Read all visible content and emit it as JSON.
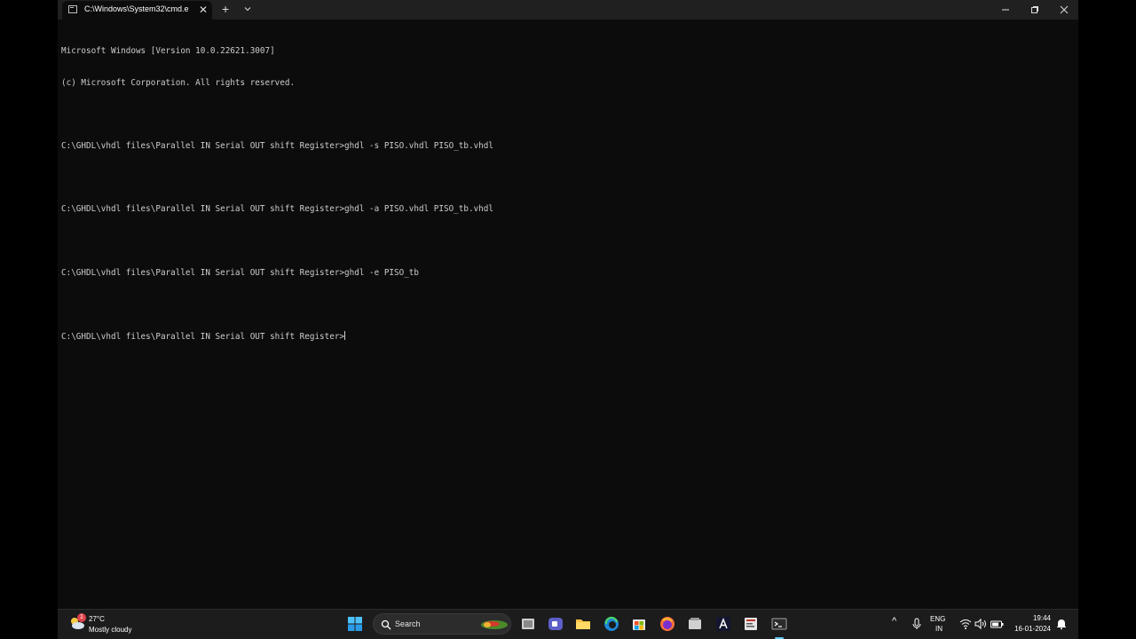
{
  "window": {
    "tab_title": "C:\\Windows\\System32\\cmd.e",
    "tab_close_glyph": "✕",
    "new_tab_glyph": "+",
    "icons": [
      "console-icon",
      "chevron-down-icon",
      "minimize-icon",
      "maximize-icon",
      "close-icon"
    ]
  },
  "console": {
    "lines": [
      "Microsoft Windows [Version 10.0.22621.3007]",
      "(c) Microsoft Corporation. All rights reserved.",
      "",
      "C:\\GHDL\\vhdl files\\Parallel IN Serial OUT shift Register>ghdl -s PISO.vhdl PISO_tb.vhdl",
      "",
      "C:\\GHDL\\vhdl files\\Parallel IN Serial OUT shift Register>ghdl -a PISO.vhdl PISO_tb.vhdl",
      "",
      "C:\\GHDL\\vhdl files\\Parallel IN Serial OUT shift Register>ghdl -e PISO_tb",
      "",
      "C:\\GHDL\\vhdl files\\Parallel IN Serial OUT shift Register>"
    ]
  },
  "taskbar": {
    "weather": {
      "badge": "1",
      "temp": "27°C",
      "desc": "Mostly cloudy"
    },
    "search": {
      "label": "Search"
    },
    "pinned_icons": [
      "start-icon",
      "search-icon",
      "task-view-icon",
      "teams-icon",
      "file-explorer-icon",
      "edge-icon",
      "store-icon",
      "firefox-icon",
      "app-icon",
      "altium-icon",
      "editor-icon",
      "terminal-icon"
    ],
    "tray": {
      "chevron_glyph": "^",
      "lang_top": "ENG",
      "lang_bottom": "IN",
      "time": "19:44",
      "date": "16-01-2024"
    }
  },
  "colors": {
    "console_bg": "#0c0c0c",
    "console_fg": "#cccccc",
    "titlebar_bg": "#202020",
    "taskbar_bg": "#1c1c1c",
    "accent": "#60cdff"
  }
}
